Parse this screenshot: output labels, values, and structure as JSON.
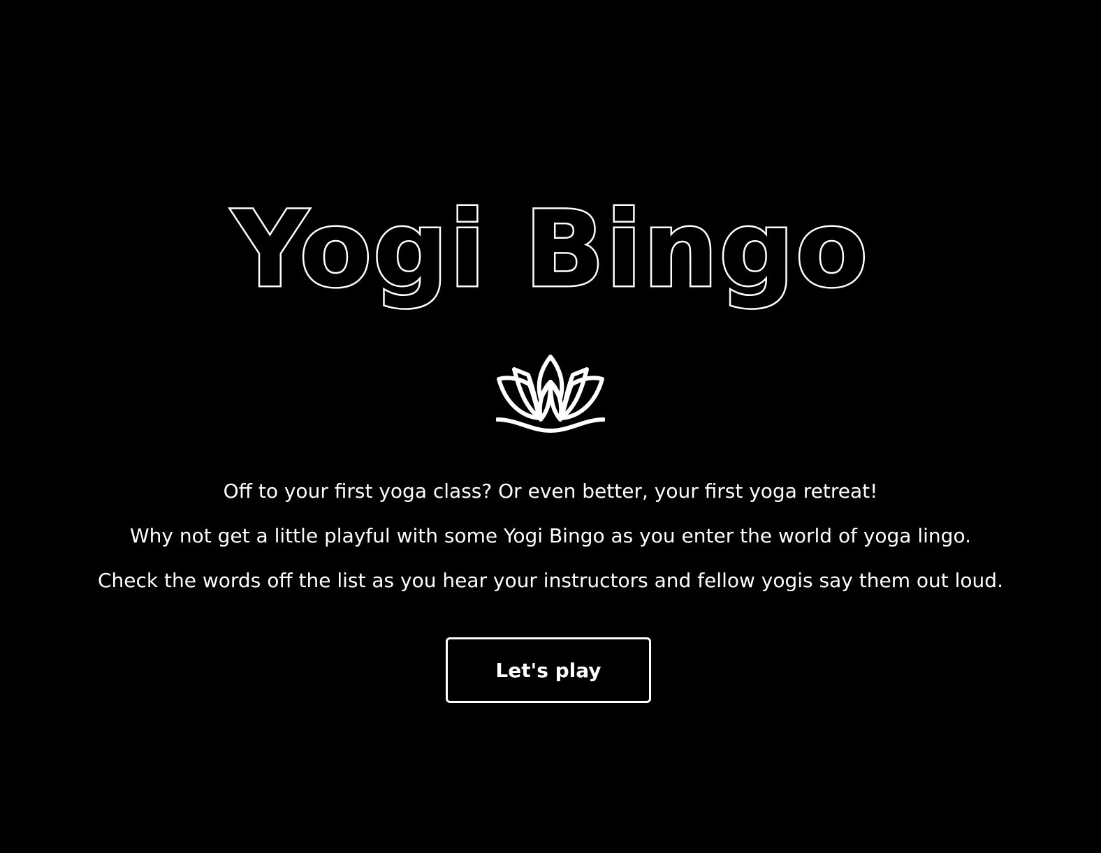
{
  "hero": {
    "title": "Yogi Bingo",
    "logo_icon": "lotus-icon"
  },
  "intro": {
    "lines": [
      "Off to your first yoga class? Or even better, your first yoga retreat!",
      "Why not get a little playful with some Yogi Bingo as you enter the world of yoga lingo.",
      "Check the words off the list as you hear your instructors and fellow yogis say them out loud."
    ]
  },
  "actions": {
    "play_label": "Let's play"
  },
  "colors": {
    "background": "#000000",
    "foreground": "#ffffff"
  }
}
